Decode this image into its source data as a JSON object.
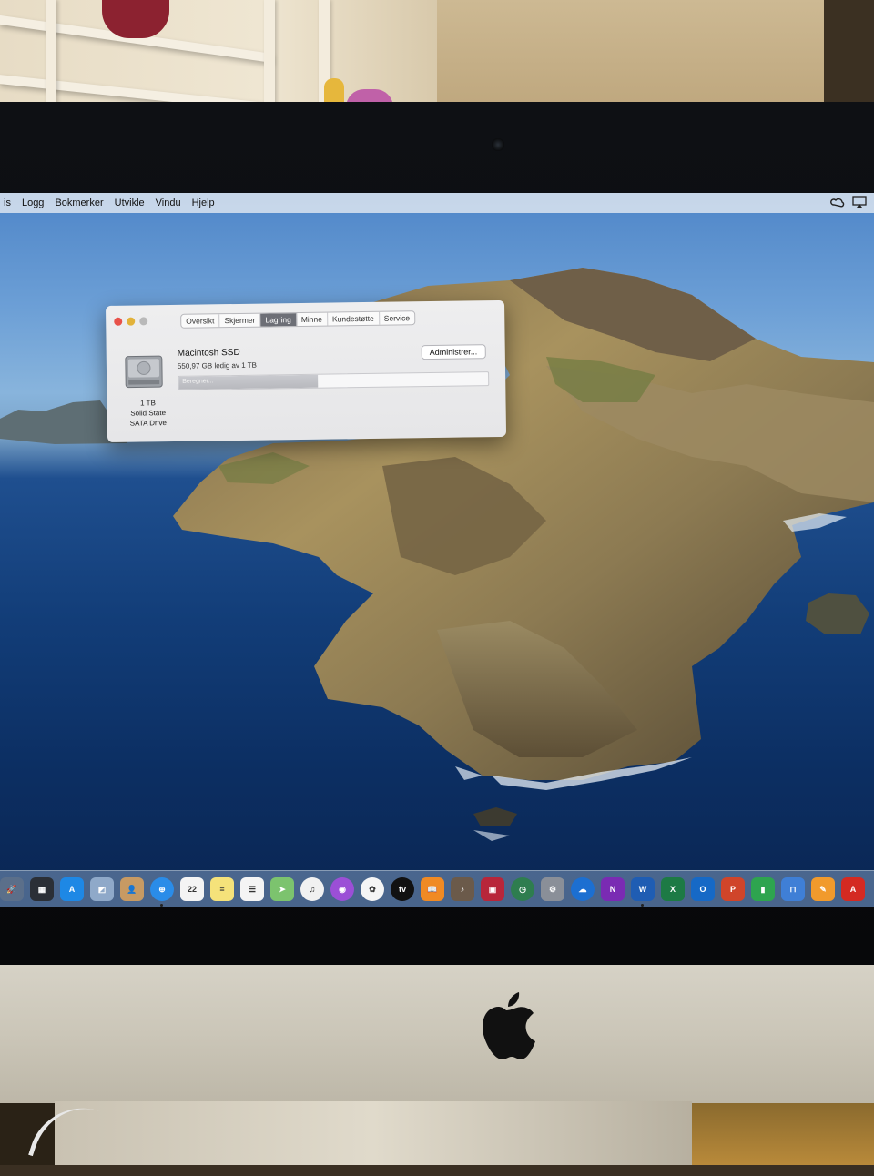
{
  "menubar": {
    "items": [
      "is",
      "Logg",
      "Bokmerker",
      "Utvikle",
      "Vindu",
      "Hjelp"
    ],
    "status_icons": [
      "creative-cloud-icon",
      "airplay-icon"
    ]
  },
  "about_window": {
    "tabs": [
      {
        "label": "Oversikt",
        "active": false
      },
      {
        "label": "Skjermer",
        "active": false
      },
      {
        "label": "Lagring",
        "active": true
      },
      {
        "label": "Minne",
        "active": false
      },
      {
        "label": "Kundestøtte",
        "active": false
      },
      {
        "label": "Service",
        "active": false
      }
    ],
    "disk": {
      "name": "Macintosh SSD",
      "free_text": "550,97 GB ledig av 1 TB",
      "capacity": "1 TB",
      "type_line1": "Solid State",
      "type_line2": "SATA Drive",
      "manage_label": "Administrer...",
      "used_fraction": 0.45,
      "bar_label": "Beregner..."
    }
  },
  "dock": {
    "icons": [
      {
        "name": "launchpad-icon",
        "color": "#5b6f8a",
        "glyph": "🚀",
        "running": false
      },
      {
        "name": "mission-control-icon",
        "color": "#2b2f36",
        "glyph": "▦",
        "running": false
      },
      {
        "name": "app-store-icon",
        "color": "#1e88e5",
        "glyph": "A",
        "running": false
      },
      {
        "name": "preview-icon",
        "color": "#8fa9c9",
        "glyph": "◩",
        "running": false
      },
      {
        "name": "contacts-icon",
        "color": "#c79a63",
        "glyph": "👤",
        "running": false
      },
      {
        "name": "safari-icon",
        "color": "#2a8ce8",
        "glyph": "⊕",
        "running": true
      },
      {
        "name": "calendar-icon",
        "color": "#f4f4f4",
        "glyph": "22",
        "running": false
      },
      {
        "name": "notes-icon",
        "color": "#f5e27a",
        "glyph": "≡",
        "running": false
      },
      {
        "name": "reminders-icon",
        "color": "#f4f4f4",
        "glyph": "☰",
        "running": false
      },
      {
        "name": "maps-icon",
        "color": "#7cc36e",
        "glyph": "➤",
        "running": false
      },
      {
        "name": "music-icon",
        "color": "#f1f1f1",
        "glyph": "♫",
        "running": false
      },
      {
        "name": "podcasts-icon",
        "color": "#9b4fd6",
        "glyph": "◉",
        "running": false
      },
      {
        "name": "photos-icon",
        "color": "#f5f5f5",
        "glyph": "✿",
        "running": false
      },
      {
        "name": "apple-tv-icon",
        "color": "#111111",
        "glyph": "tv",
        "running": false
      },
      {
        "name": "books-icon",
        "color": "#f08a24",
        "glyph": "📖",
        "running": false
      },
      {
        "name": "instruments-icon",
        "color": "#6b5a4a",
        "glyph": "♪",
        "running": false
      },
      {
        "name": "photo-booth-icon",
        "color": "#b8263a",
        "glyph": "▣",
        "running": false
      },
      {
        "name": "time-machine-icon",
        "color": "#2e7d4f",
        "glyph": "◷",
        "running": false
      },
      {
        "name": "system-preferences-icon",
        "color": "#8a8f98",
        "glyph": "⚙",
        "running": false
      },
      {
        "name": "onedrive-icon",
        "color": "#1c6fd1",
        "glyph": "☁",
        "running": false
      },
      {
        "name": "onenote-icon",
        "color": "#7a2bb3",
        "glyph": "N",
        "running": false
      },
      {
        "name": "word-icon",
        "color": "#1f5db3",
        "glyph": "W",
        "running": true
      },
      {
        "name": "excel-icon",
        "color": "#1d7a45",
        "glyph": "X",
        "running": false
      },
      {
        "name": "outlook-icon",
        "color": "#1669c6",
        "glyph": "O",
        "running": false
      },
      {
        "name": "powerpoint-icon",
        "color": "#d0452a",
        "glyph": "P",
        "running": false
      },
      {
        "name": "numbers-icon",
        "color": "#2ea44f",
        "glyph": "▮",
        "running": false
      },
      {
        "name": "keynote-icon",
        "color": "#3f7fd6",
        "glyph": "⊓",
        "running": false
      },
      {
        "name": "pages-icon",
        "color": "#f19a2c",
        "glyph": "✎",
        "running": false
      },
      {
        "name": "acrobat-icon",
        "color": "#d42a22",
        "glyph": "A",
        "running": false
      }
    ]
  }
}
